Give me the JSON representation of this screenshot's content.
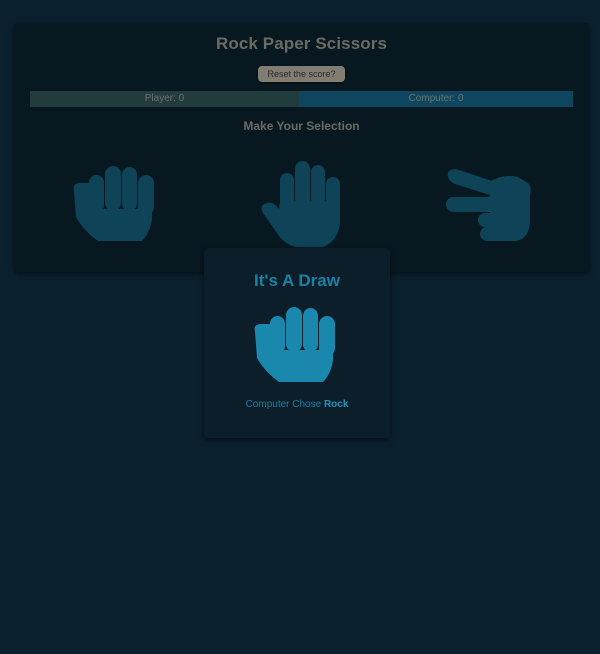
{
  "game": {
    "title": "Rock Paper Scissors",
    "reset_label": "Reset the score?",
    "scores": {
      "player": "Player: 0",
      "computer": "Computer: 0"
    },
    "selection_heading": "Make Your Selection",
    "choices": [
      {
        "name": "rock",
        "icon": "rock-fist-icon"
      },
      {
        "name": "paper",
        "icon": "paper-hand-icon"
      },
      {
        "name": "scissors",
        "icon": "scissors-hand-icon"
      }
    ]
  },
  "result": {
    "heading": "It's A Draw",
    "computer_chose_prefix": "Computer Chose",
    "computer_choice": "Rock",
    "icon": "rock-fist-icon"
  },
  "colors": {
    "background": "#0b202f",
    "card": "#081820",
    "choice_icon": "#0e4358",
    "result_accent": "#1e7fa4",
    "result_icon": "#1a87ad",
    "player_bar": "#223b3d",
    "computer_bar": "#0f465f",
    "heading_text": "#6b6b62"
  }
}
